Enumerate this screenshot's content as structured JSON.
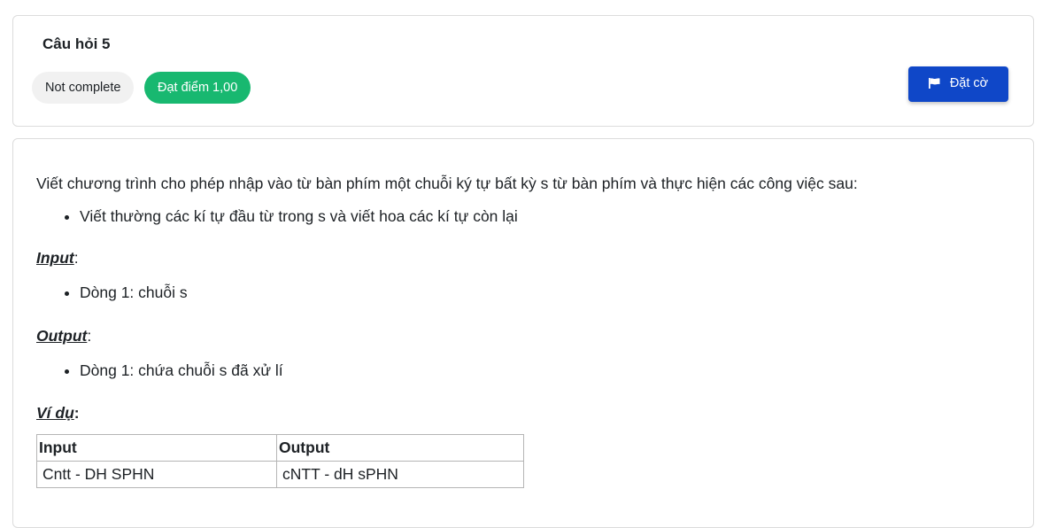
{
  "question": {
    "title": "Câu hỏi 5",
    "status": "Not complete",
    "grade": "Đạt điểm 1,00",
    "flag_label": "Đặt cờ",
    "flag_icon": "flag-icon"
  },
  "colors": {
    "grade_badge": "#18b870",
    "flag_button": "#0f47c8",
    "status_badge": "#f1f1f1"
  },
  "problem": {
    "intro": "Viết chương trình cho phép nhập vào từ bàn phím một chuỗi ký tự bất kỳ s từ bàn phím và thực hiện các công việc sau:",
    "requirements": [
      "Viết thường các kí tự đầu từ trong s và viết hoa các kí tự còn lại"
    ],
    "input_label": "Input",
    "input_items": [
      "Dòng 1: chuỗi s"
    ],
    "output_label": "Output",
    "output_items": [
      "Dòng 1: chứa chuỗi s đã xử lí"
    ],
    "example_label": "Ví dụ",
    "example_table": {
      "headers": [
        "Input",
        "Output"
      ],
      "rows": [
        [
          "Cntt - DH SPHN",
          "cNTT - dH sPHN"
        ]
      ]
    }
  }
}
